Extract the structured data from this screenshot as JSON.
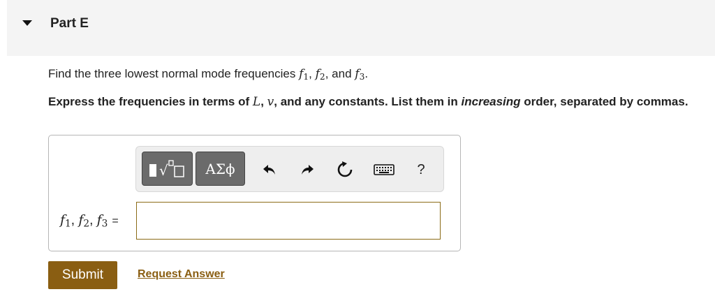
{
  "part": {
    "title": "Part E"
  },
  "question": {
    "prefix": "Find the three lowest normal mode frequencies ",
    "f": "f",
    "s1": "1",
    "s2": "2",
    "s3": "3",
    "comma": ", ",
    "and": ", and ",
    "end": "."
  },
  "instruction": {
    "part1": "Express the frequencies in terms of ",
    "L": "L",
    "comma": ", ",
    "v": "v",
    "part2": ", and any constants. List them in ",
    "emph": "increasing",
    "part3": " order, separated by commas."
  },
  "toolbar": {
    "templates_icon": "templates-icon",
    "symbols_label": "ΑΣϕ",
    "undo_icon": "undo-icon",
    "redo_icon": "redo-icon",
    "reset_icon": "reset-icon",
    "keyboard_icon": "keyboard-icon",
    "help_label": "?"
  },
  "answer": {
    "equals": "=",
    "value": ""
  },
  "actions": {
    "submit_label": "Submit",
    "request_label": "Request Answer"
  },
  "colors": {
    "accent": "#8a5e12",
    "header_bg": "#f4f4f4",
    "toolbar_button": "#6b6b6b"
  }
}
